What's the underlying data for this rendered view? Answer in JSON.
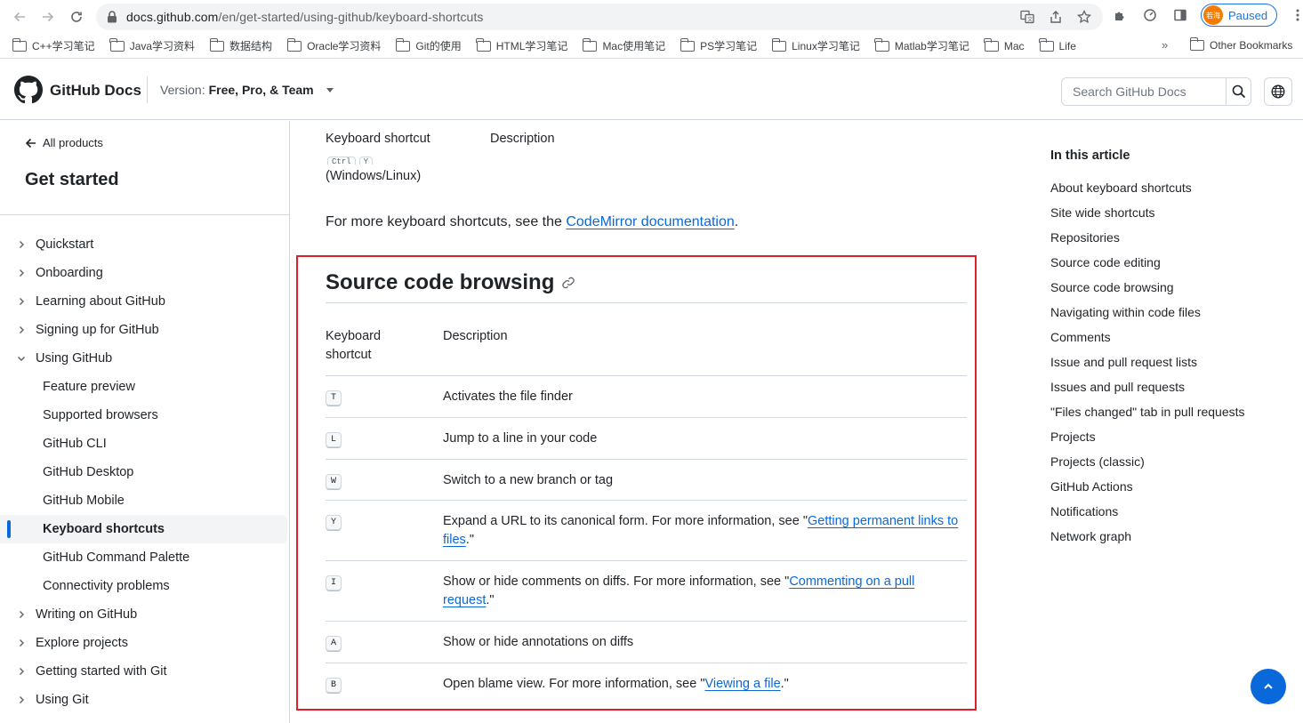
{
  "browser": {
    "url_host": "docs.github.com",
    "url_path": "/en/get-started/using-github/keyboard-shortcuts",
    "profile_status": "Paused",
    "profile_avatar_text": "若海",
    "bookmarks": [
      "C++学习笔记",
      "Java学习资料",
      "数据结构",
      "Oracle学习资料",
      "Git的使用",
      "HTML学习笔记",
      "Mac使用笔记",
      "PS学习笔记",
      "Linux学习笔记",
      "Matlab学习笔记",
      "Mac",
      "Life"
    ],
    "bookmarks_overflow": "»",
    "other_bookmarks": "Other Bookmarks"
  },
  "header": {
    "brand": "GitHub Docs",
    "version_label": "Version:",
    "version_value": "Free, Pro, & Team",
    "search_placeholder": "Search GitHub Docs"
  },
  "sidebar": {
    "back_label": "All products",
    "title": "Get started",
    "items": [
      {
        "label": "Quickstart",
        "type": "collapsed"
      },
      {
        "label": "Onboarding",
        "type": "collapsed"
      },
      {
        "label": "Learning about GitHub",
        "type": "collapsed"
      },
      {
        "label": "Signing up for GitHub",
        "type": "collapsed"
      },
      {
        "label": "Using GitHub",
        "type": "expanded"
      },
      {
        "label": "Feature preview",
        "type": "child"
      },
      {
        "label": "Supported browsers",
        "type": "child"
      },
      {
        "label": "GitHub CLI",
        "type": "child"
      },
      {
        "label": "GitHub Desktop",
        "type": "child"
      },
      {
        "label": "GitHub Mobile",
        "type": "child"
      },
      {
        "label": "Keyboard shortcuts",
        "type": "child-active"
      },
      {
        "label": "GitHub Command Palette",
        "type": "child"
      },
      {
        "label": "Connectivity problems",
        "type": "child"
      },
      {
        "label": "Writing on GitHub",
        "type": "collapsed"
      },
      {
        "label": "Explore projects",
        "type": "collapsed"
      },
      {
        "label": "Getting started with Git",
        "type": "collapsed"
      },
      {
        "label": "Using Git",
        "type": "collapsed"
      }
    ]
  },
  "main": {
    "prev_table": {
      "col_shortcut": "Keyboard shortcut",
      "col_description": "Description",
      "partial_keys": [
        "Ctrl",
        "Y"
      ],
      "os_note": "(Windows/Linux)"
    },
    "more_shortcuts": {
      "prefix": "For more keyboard shortcuts, see the ",
      "link": "CodeMirror documentation",
      "suffix": "."
    },
    "section": {
      "title": "Source code browsing",
      "col_shortcut": "Keyboard shortcut",
      "col_description": "Description",
      "rows": [
        {
          "key": "T",
          "text": "Activates the file finder"
        },
        {
          "key": "L",
          "text": "Jump to a line in your code"
        },
        {
          "key": "W",
          "text": "Switch to a new branch or tag"
        },
        {
          "key": "Y",
          "pre": "Expand a URL to its canonical form. For more information, see \"",
          "link": "Getting permanent links to files",
          "post": ".\""
        },
        {
          "key": "I",
          "pre": "Show or hide comments on diffs. For more information, see \"",
          "link": "Commenting on a pull request",
          "post": ".\""
        },
        {
          "key": "A",
          "text": "Show or hide annotations on diffs"
        },
        {
          "key": "B",
          "pre": "Open blame view. For more information, see \"",
          "link": "Viewing a file",
          "post": ".\""
        }
      ]
    }
  },
  "toc": {
    "title": "In this article",
    "items": [
      "About keyboard shortcuts",
      "Site wide shortcuts",
      "Repositories",
      "Source code editing",
      "Source code browsing",
      "Navigating within code files",
      "Comments",
      "Issue and pull request lists",
      "Issues and pull requests",
      "\"Files changed\" tab in pull requests",
      "Projects",
      "Projects (classic)",
      "GitHub Actions",
      "Notifications",
      "Network graph"
    ]
  },
  "colors": {
    "link": "#0969da",
    "highlight_border": "#e01e2c",
    "active_indicator": "#0969da"
  }
}
